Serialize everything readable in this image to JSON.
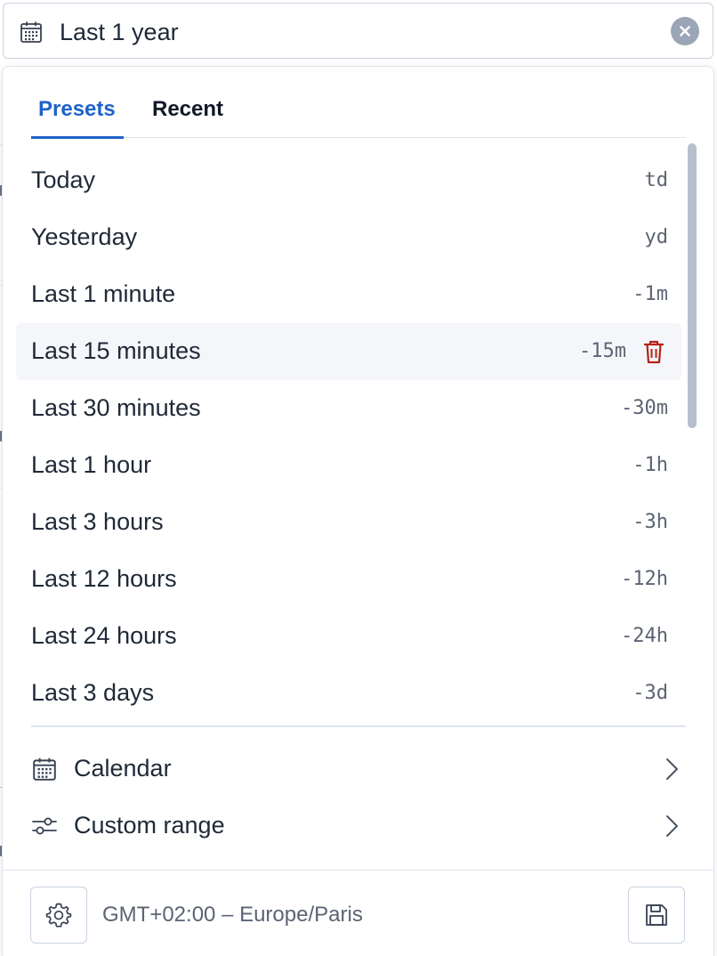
{
  "range_input": {
    "value": "Last 1 year",
    "calendar_icon": "calendar-icon",
    "clear_icon": "close-icon"
  },
  "tabs": [
    {
      "label": "Presets",
      "active": true
    },
    {
      "label": "Recent",
      "active": false
    }
  ],
  "presets": [
    {
      "label": "Today",
      "code": "td"
    },
    {
      "label": "Yesterday",
      "code": "yd"
    },
    {
      "label": "Last 1 minute",
      "code": "-1m"
    },
    {
      "label": "Last 15 minutes",
      "code": "-15m",
      "hovered": true,
      "delete_icon": "trash-icon"
    },
    {
      "label": "Last 30 minutes",
      "code": "-30m"
    },
    {
      "label": "Last 1 hour",
      "code": "-1h"
    },
    {
      "label": "Last 3 hours",
      "code": "-3h"
    },
    {
      "label": "Last 12 hours",
      "code": "-12h"
    },
    {
      "label": "Last 24 hours",
      "code": "-24h"
    },
    {
      "label": "Last 3 days",
      "code": "-3d"
    }
  ],
  "nav": [
    {
      "label": "Calendar",
      "icon": "calendar-icon"
    },
    {
      "label": "Custom range",
      "icon": "sliders-icon"
    }
  ],
  "footer": {
    "timezone": "GMT+02:00 – Europe/Paris",
    "settings_icon": "gear-icon",
    "save_icon": "save-icon"
  },
  "colors": {
    "accent": "#1f62c8",
    "danger": "#b42318",
    "hover_row": "#f4f6fa",
    "muted_text": "#5b6474",
    "border": "#c9d2e0"
  }
}
